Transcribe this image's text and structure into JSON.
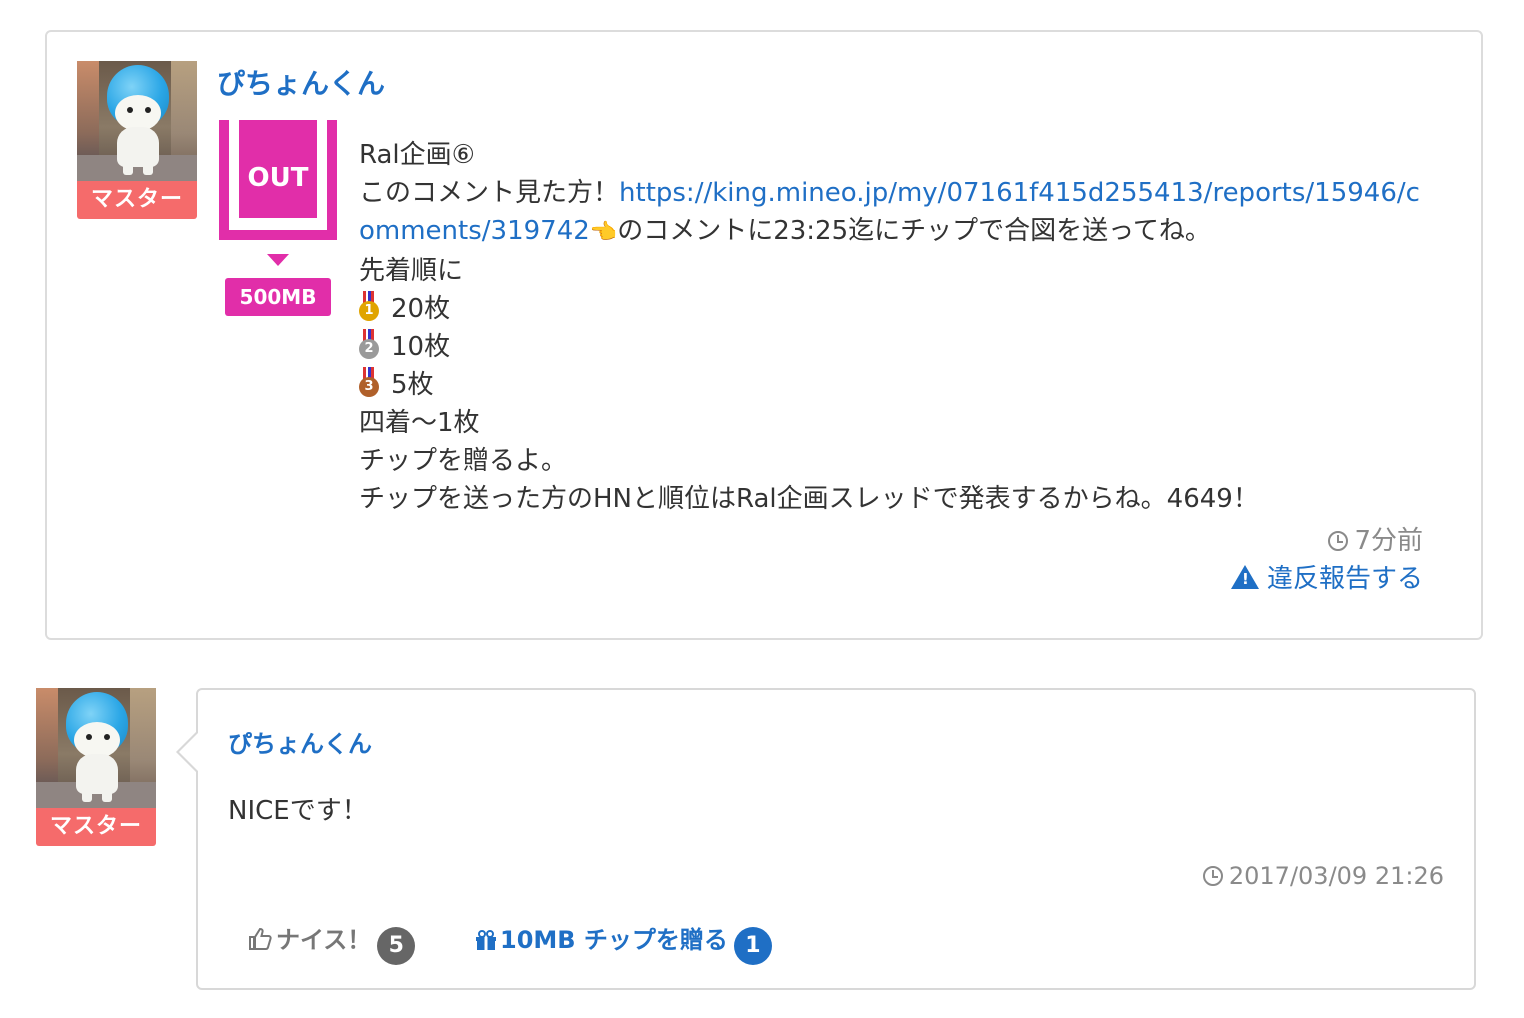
{
  "post": {
    "username": "ぴちょんくん",
    "badge": "マスター",
    "status_icon_label": "OUT",
    "data_badge": "500MB",
    "line_title": "Ral企画⑥",
    "line_2_prefix": "このコメント見た方！",
    "link_part1": "https://king.mineo.jp/my/07161f415d255413/reports/15946/c",
    "link_part2": "omments/319742",
    "pointing_emoji": "👈",
    "line_3_suffix": "のコメントに23:25迄にチップで合図を送ってね。",
    "line_order": "先着順に",
    "prizes": [
      {
        "medal": "1",
        "text": "20枚",
        "color": "#e0a400"
      },
      {
        "medal": "2",
        "text": "10枚",
        "color": "#9a9a9a"
      },
      {
        "medal": "3",
        "text": "5枚",
        "color": "#b0602a"
      }
    ],
    "line_fourth": "四着〜1枚",
    "line_send": "チップを贈るよ。",
    "line_announce": "チップを送った方のHNと順位はRal企画スレッドで発表するからね。4649！",
    "time": "7分前",
    "report_label": "違反報告する"
  },
  "reply": {
    "username": "ぴちょんくん",
    "badge": "マスター",
    "text": "NICEです！",
    "timestamp": "2017/03/09 21:26",
    "nice_label": "ナイス！",
    "nice_count": "5",
    "tip_label": "10MB チップを贈る",
    "tip_count": "1"
  },
  "colors": {
    "link": "#1f6fc5",
    "master_badge": "#f56b6b",
    "data_badge": "#e12ea9",
    "muted": "#8a8a8a"
  },
  "icons": [
    "clock-icon",
    "warning-icon",
    "thumbs-up-icon",
    "gift-icon",
    "medal-icon"
  ]
}
